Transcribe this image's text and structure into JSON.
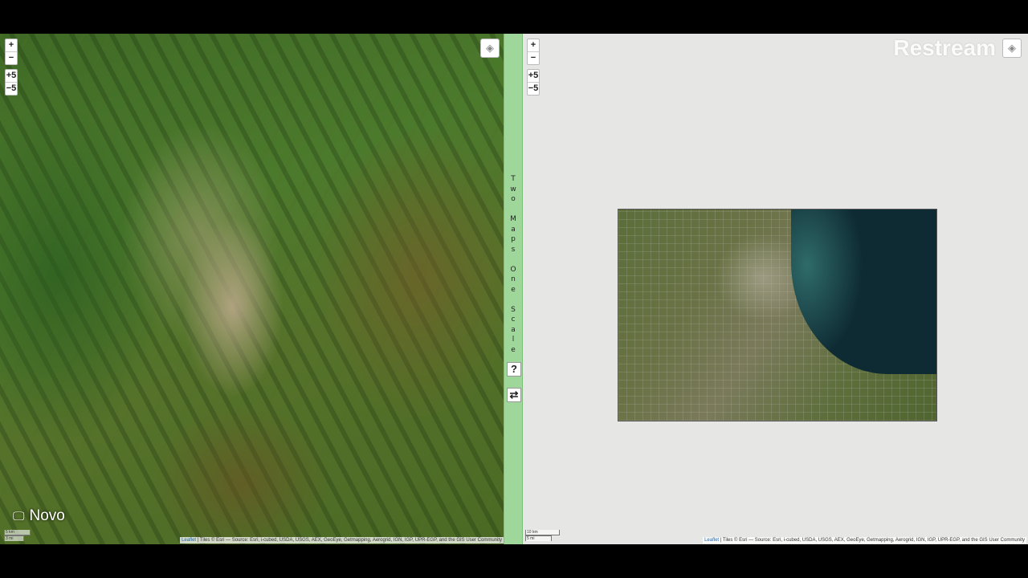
{
  "title_letters": [
    "T",
    "w",
    "o",
    "",
    "M",
    "a",
    "p",
    "s",
    "",
    "O",
    "n",
    "e",
    "",
    "S",
    "c",
    "a",
    "l",
    "e"
  ],
  "left_map": {
    "zoom_in": "+",
    "zoom_out": "−",
    "zoom_plus5": "+5",
    "zoom_minus5": "−5",
    "layers_icon": "layers-icon",
    "scale_km": "5 km",
    "scale_mi": "3 mi",
    "attribution_leaflet": "Leaflet",
    "attribution_text": " | Tiles © Esri — Source: Esri, i-cubed, USDA, USGS, AEX, GeoEye, Getmapping, Aerogrid, IGN, IGP, UPR-EGP, and the GIS User Community"
  },
  "right_map": {
    "zoom_in": "+",
    "zoom_out": "−",
    "zoom_plus5": "+5",
    "zoom_minus5": "−5",
    "scale_km": "10 km",
    "scale_mi": "5 mi",
    "attribution_leaflet": "Leaflet",
    "attribution_text": " | Tiles © Esri — Source: Esri, i-cubed, USDA, USGS, AEX, GeoEye, Getmapping, Aerogrid, IGN, IGP, UPR-EGP, and the GIS User Community"
  },
  "help_label": "?",
  "swap_label": "⇄",
  "brand": "Restream",
  "overlay_label": "Novo",
  "colors": {
    "divider": "#9fd79b",
    "right_background": "#e6e6e4"
  }
}
